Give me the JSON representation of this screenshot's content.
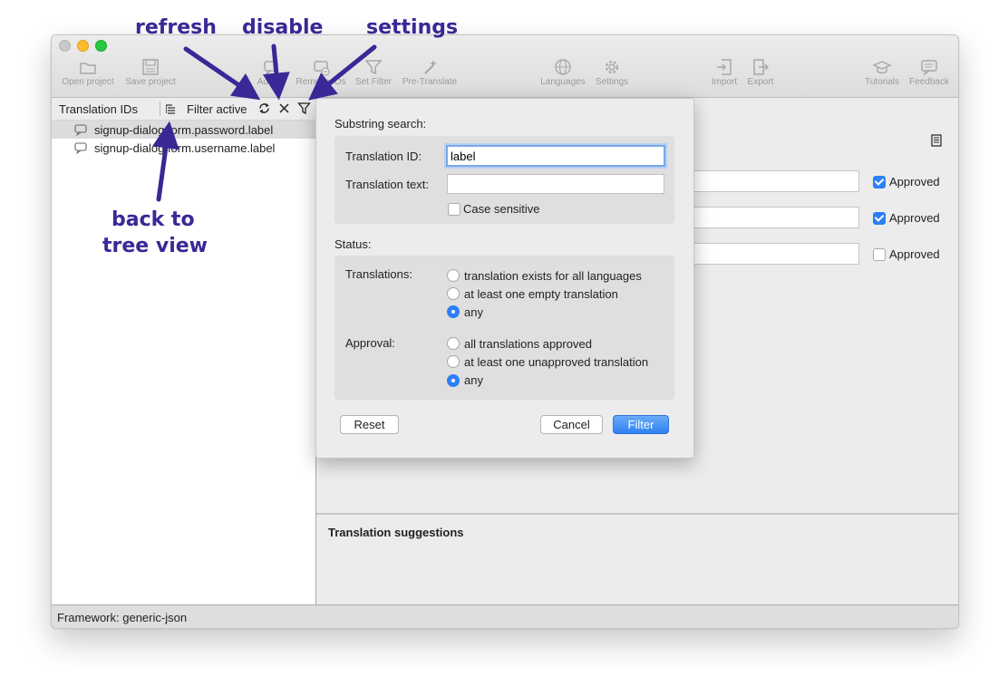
{
  "toolbar": {
    "items": [
      {
        "label": "Open project",
        "icon": "folder-icon"
      },
      {
        "label": "Save project",
        "icon": "floppy-icon"
      },
      {
        "label": "Add ID",
        "icon": "comment-add-icon"
      },
      {
        "label": "Remove IDs",
        "icon": "comment-remove-icon"
      },
      {
        "label": "Set Filter",
        "icon": "funnel-icon"
      },
      {
        "label": "Pre-Translate",
        "icon": "magic-wand-icon"
      },
      {
        "label": "Languages",
        "icon": "globe-icon"
      },
      {
        "label": "Settings",
        "icon": "gear-icon"
      },
      {
        "label": "Import",
        "icon": "import-icon"
      },
      {
        "label": "Export",
        "icon": "export-icon"
      },
      {
        "label": "Tutorials",
        "icon": "graduation-cap-icon"
      },
      {
        "label": "Feedback",
        "icon": "feedback-icon"
      }
    ]
  },
  "left_pane": {
    "title": "Translation IDs",
    "filter_status": "Filter active",
    "ids": [
      {
        "label": "signup-dialog.form.password.label",
        "selected": true
      },
      {
        "label": "signup-dialog.form.username.label",
        "selected": false
      }
    ]
  },
  "translations": [
    {
      "approved": true,
      "approved_label": "Approved"
    },
    {
      "approved": true,
      "approved_label": "Approved"
    },
    {
      "approved": false,
      "approved_label": "Approved"
    }
  ],
  "filter_popover": {
    "substring_heading": "Substring search:",
    "translation_id_label": "Translation ID:",
    "translation_id_value": "label",
    "translation_text_label": "Translation text:",
    "translation_text_value": "",
    "case_sensitive_label": "Case sensitive",
    "case_sensitive_checked": false,
    "status_heading": "Status:",
    "translations_label": "Translations:",
    "translations_options": [
      {
        "label": "translation exists for all languages",
        "selected": false
      },
      {
        "label": "at least one empty translation",
        "selected": false
      },
      {
        "label": "any",
        "selected": true
      }
    ],
    "approval_label": "Approval:",
    "approval_options": [
      {
        "label": "all translations approved",
        "selected": false
      },
      {
        "label": "at least one unapproved translation",
        "selected": false
      },
      {
        "label": "any",
        "selected": true
      }
    ],
    "reset_label": "Reset",
    "cancel_label": "Cancel",
    "filter_label": "Filter"
  },
  "suggestions": {
    "title": "Translation suggestions"
  },
  "status_bar": {
    "framework": "Framework: generic-json"
  },
  "annotations": {
    "refresh": "refresh",
    "disable": "disable",
    "settings": "settings",
    "back_to_tree_view_line1": "back to",
    "back_to_tree_view_line2": "tree view"
  },
  "colors": {
    "accent": "#2d7ff5",
    "annotation": "#3b2796"
  }
}
